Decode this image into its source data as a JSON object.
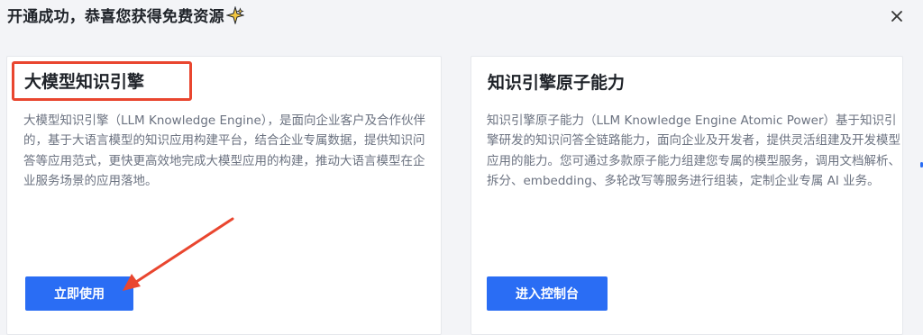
{
  "dialog": {
    "title": "开通成功，恭喜您获得免费资源",
    "title_emoji_icon": "sparkle-icon",
    "close_icon": "close-icon"
  },
  "cards": [
    {
      "title": "大模型知识引擎",
      "description": "大模型知识引擎（LLM Knowledge Engine），是面向企业客户及合作伙伴的，基于大语言模型的知识应用构建平台，结合企业专属数据，提供知识问答等应用范式，更快更高效地完成大模型应用的构建，推动大语言模型在企业服务场景的应用落地。",
      "button_label": "立即使用"
    },
    {
      "title": "知识引擎原子能力",
      "description": "知识引擎原子能力（LLM Knowledge Engine Atomic Power）基于知识引擎研发的知识问答全链路能力，面向企业及开发者，提供灵活组建及开发模型应用的能力。您可通过多款原子能力组建您专属的模型服务，调用文档解析、拆分、embedding、多轮改写等服务进行组装，定制企业专属 AI 业务。",
      "button_label": "进入控制台"
    }
  ],
  "colors": {
    "primary": "#2a6df4",
    "annotation": "#e9462f",
    "background": "#f3f4f7",
    "card": "#ffffff",
    "text_secondary": "#6b7280"
  }
}
